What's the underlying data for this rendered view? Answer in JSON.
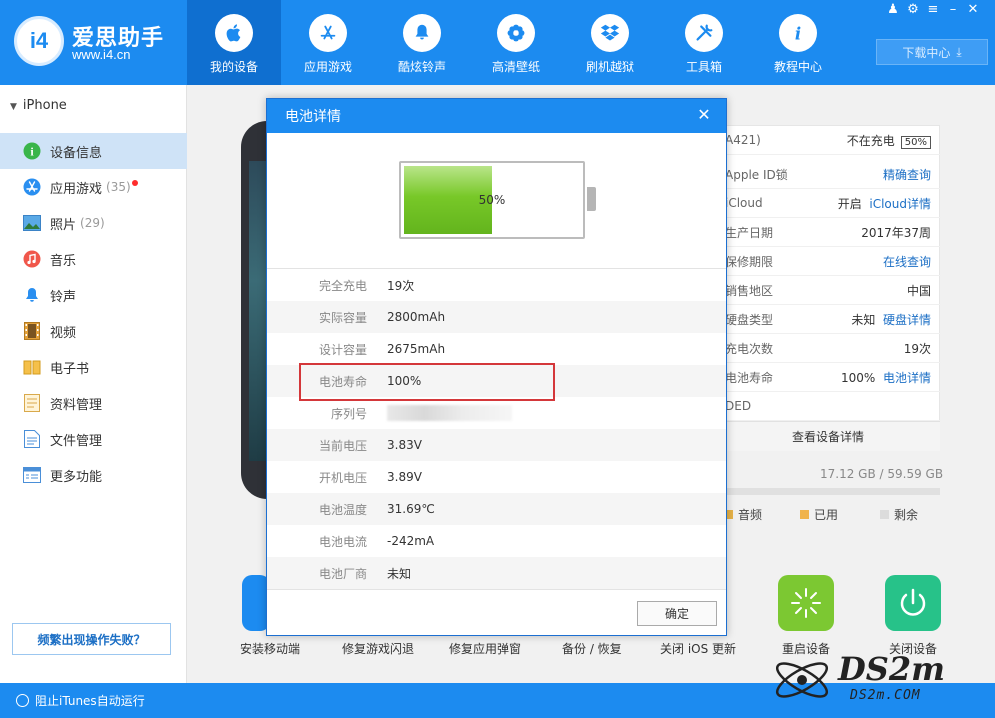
{
  "brand": {
    "logo_text": "i4",
    "title": "爱思助手",
    "url": "www.i4.cn"
  },
  "nav": [
    {
      "label": "我的设备",
      "icon": "apple-icon"
    },
    {
      "label": "应用游戏",
      "icon": "app-store-icon"
    },
    {
      "label": "酷炫铃声",
      "icon": "bell-icon"
    },
    {
      "label": "高清壁纸",
      "icon": "flower-icon"
    },
    {
      "label": "刷机越狱",
      "icon": "dropbox-icon"
    },
    {
      "label": "工具箱",
      "icon": "tools-icon"
    },
    {
      "label": "教程中心",
      "icon": "info-icon"
    }
  ],
  "download_label": "下载中心",
  "sidebar": {
    "device_name": "iPhone",
    "items": [
      {
        "label": "设备信息",
        "count": ""
      },
      {
        "label": "应用游戏",
        "count": "(35)"
      },
      {
        "label": "照片",
        "count": "(29)"
      },
      {
        "label": "音乐",
        "count": ""
      },
      {
        "label": "铃声",
        "count": ""
      },
      {
        "label": "视频",
        "count": ""
      },
      {
        "label": "电子书",
        "count": ""
      },
      {
        "label": "资料管理",
        "count": ""
      },
      {
        "label": "文件管理",
        "count": ""
      },
      {
        "label": "更多功能",
        "count": ""
      }
    ],
    "help_label": "频繁出现操作失败？"
  },
  "bottom": {
    "itunes_label": "阻止iTunes自动运行"
  },
  "info": {
    "model_partial": "A421)",
    "charge_status": "不在充电",
    "charge_percent": "50%",
    "rows": [
      {
        "k": "Apple ID锁",
        "v": "精确查询"
      },
      {
        "k": "iCloud",
        "v1": "开启",
        "v": "iCloud详情"
      },
      {
        "k": "生产日期",
        "v": "2017年37周"
      },
      {
        "k": "保修期限",
        "v": "在线查询"
      },
      {
        "k": "销售地区",
        "v": "中国"
      },
      {
        "k": "硬盘类型",
        "v1": "未知",
        "v": "硬盘详情"
      },
      {
        "k": "充电次数",
        "v": "19次"
      },
      {
        "k": "电池寿命",
        "v1": "100%",
        "v": "电池详情"
      },
      {
        "k": "DED",
        "v": ""
      }
    ],
    "detail_button": "查看设备详情",
    "storage": "17.12 GB / 59.59 GB",
    "legend": [
      "音频",
      "已用",
      "剩余"
    ]
  },
  "tools": [
    {
      "label": "安装移动端"
    },
    {
      "label": "修复游戏闪退"
    },
    {
      "label": "修复应用弹窗"
    },
    {
      "label": "备份 / 恢复"
    },
    {
      "label": "关闭 iOS 更新"
    },
    {
      "label": "重启设备"
    },
    {
      "label": "关闭设备"
    }
  ],
  "watermark": {
    "text": "DS2m",
    "sub": "DS2m.COM"
  },
  "modal": {
    "title": "电池详情",
    "battery_percent": 50,
    "battery_label": "50%",
    "rows": [
      {
        "k": "完全充电",
        "v": "19次"
      },
      {
        "k": "实际容量",
        "v": "2800mAh"
      },
      {
        "k": "设计容量",
        "v": "2675mAh"
      },
      {
        "k": "电池寿命",
        "v": "100%"
      },
      {
        "k": "序列号",
        "v": ""
      },
      {
        "k": "当前电压",
        "v": "3.83V"
      },
      {
        "k": "开机电压",
        "v": "3.89V"
      },
      {
        "k": "电池温度",
        "v": "31.69℃"
      },
      {
        "k": "电池电流",
        "v": "-242mA"
      },
      {
        "k": "电池厂商",
        "v": "未知"
      }
    ],
    "ok_label": "确定"
  },
  "colors": {
    "accent": "#1c8bf0",
    "highlight": "#d4373a",
    "battery_green": "#78c828"
  }
}
